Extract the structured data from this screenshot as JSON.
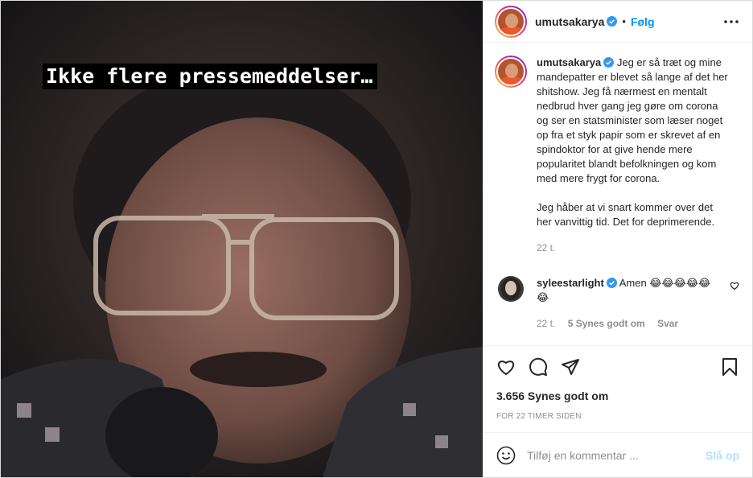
{
  "media": {
    "overlay_text": "Ikke flere pressemeddelser…"
  },
  "header": {
    "username": "umutsakarya",
    "separator": "•",
    "follow_label": "Følg",
    "more_icon": "more-horizontal-icon"
  },
  "caption": {
    "username": "umutsakarya",
    "paragraph1": "Jeg er så træt og mine mandepatter er blevet så lange af det her shitshow. Jeg få nærmest en mentalt nedbrud hver gang jeg gøre om corona og ser en statsminister som læser noget op fra et styk papir som er skrevet af en spindoktor for at give hende mere popularitet blandt befolkningen og kom med mere frygt for corona.",
    "paragraph2": "Jeg håber at vi snart kommer over det her vanvittig tid. Det for deprimerende.",
    "time": "22 t."
  },
  "comment": {
    "username": "syleestarlight",
    "text": "Amen 😂😂😂😂😂😂",
    "time": "22 t.",
    "likes": "5 Synes godt om",
    "reply": "Svar"
  },
  "actions": {
    "likes": "3.656 Synes godt om",
    "timestamp": "FOR 22 TIMER SIDEN"
  },
  "add_comment": {
    "placeholder": "Tilføj en kommentar ...",
    "post_label": "Slå op"
  },
  "colors": {
    "accent": "#0095f6",
    "post_disabled": "#b2dffc",
    "muted": "#8e8e8e"
  }
}
